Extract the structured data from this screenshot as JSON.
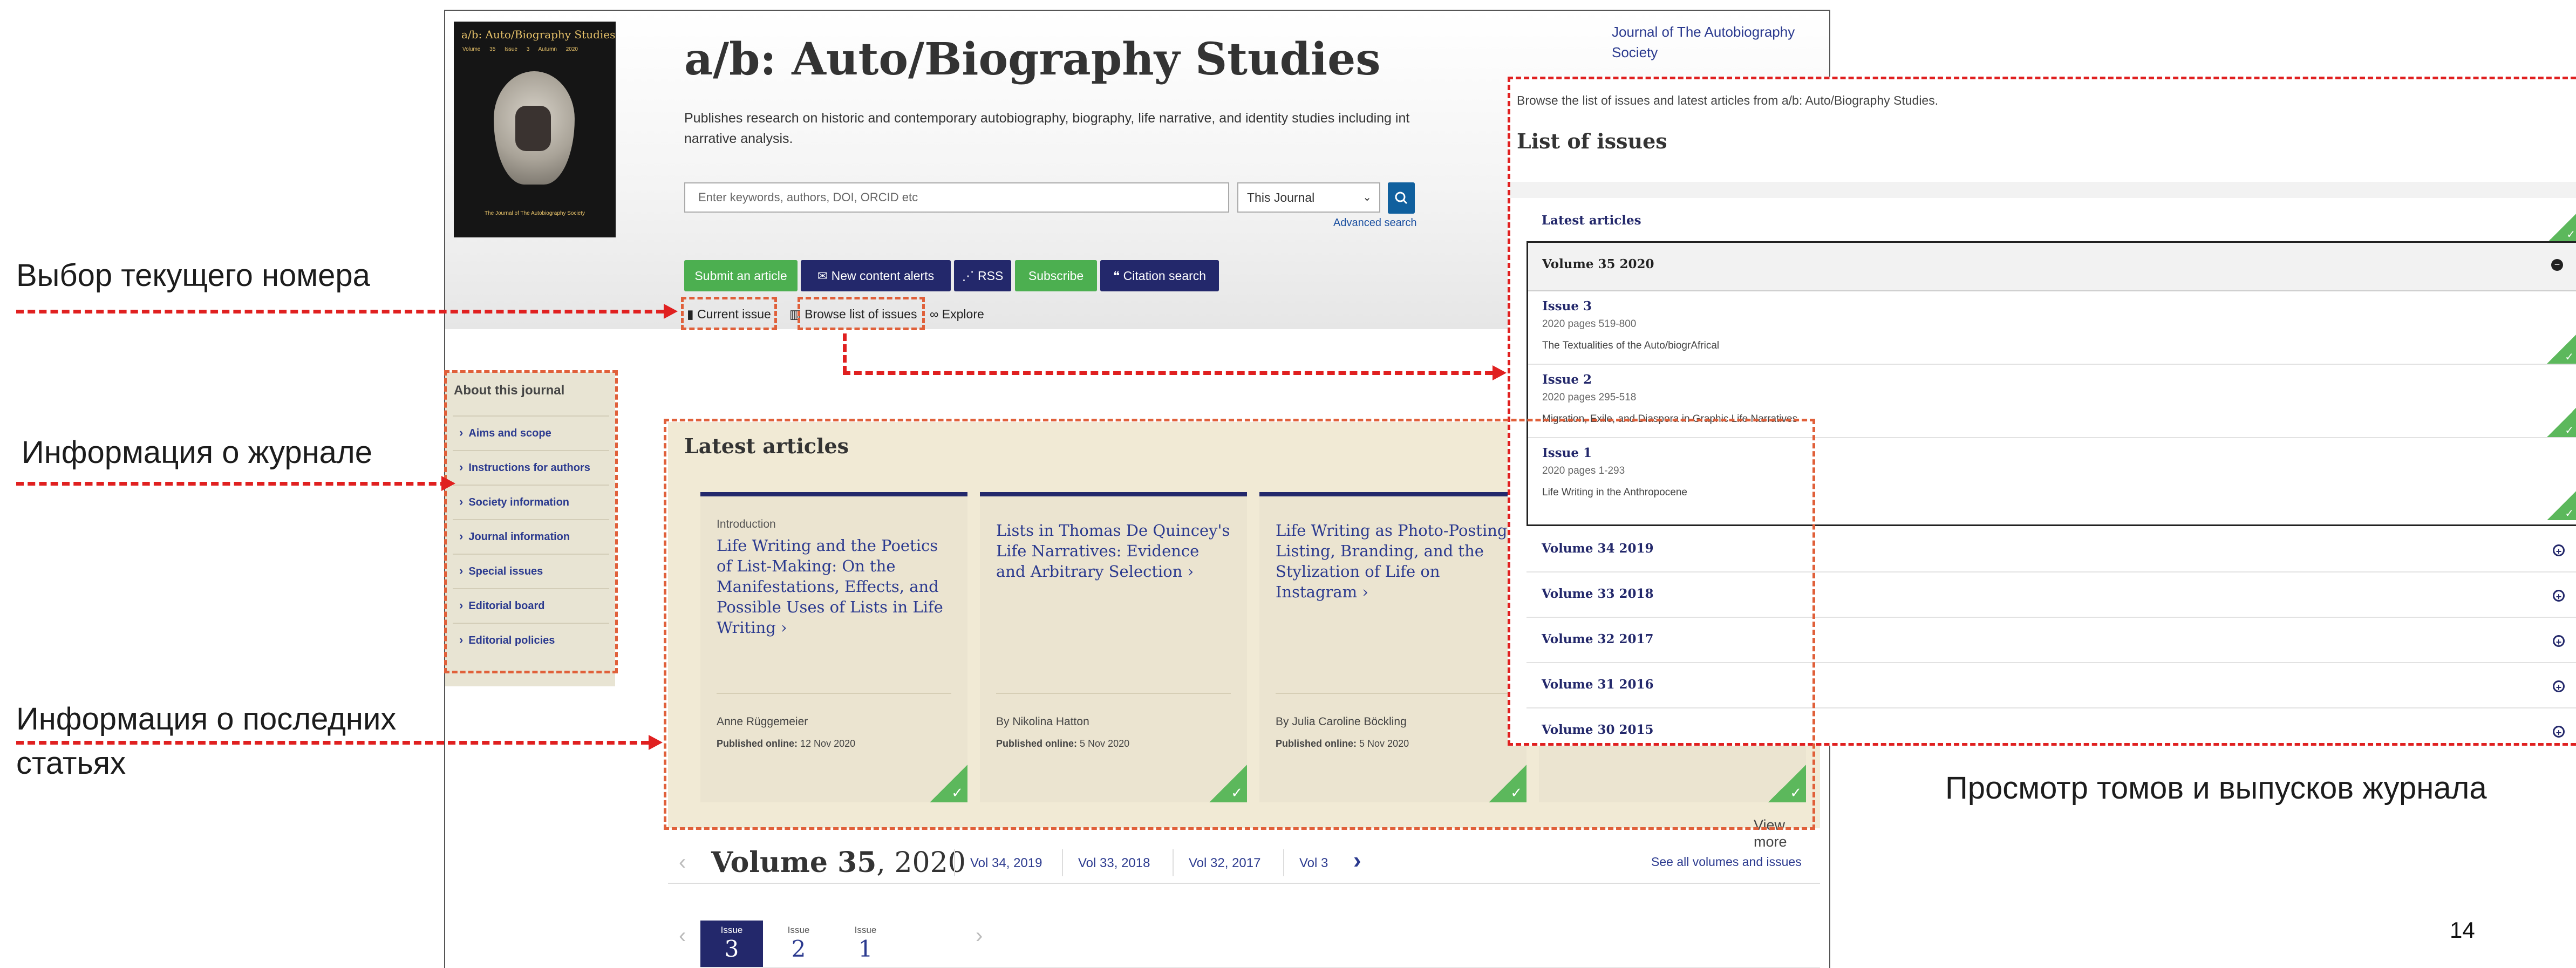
{
  "journal": {
    "title": "a/b: Auto/Biography Studies",
    "description": "Publishes research on historic and contemporary autobiography, biography, life narrative, and identity studies including int",
    "description_line2": "narrative analysis.",
    "society_link": "Journal of The Autobiography Society",
    "cover": {
      "title": "a/b: Auto/Biography Studies",
      "volume_line": "Volume 35 Issue 3 Autumn 2020",
      "caption": "The Journal of The Autobiography Society"
    }
  },
  "search": {
    "placeholder": "Enter keywords, authors, DOI, ORCID etc",
    "scope": "This Journal",
    "advanced": "Advanced search",
    "search_icon": "search-icon"
  },
  "actions": {
    "submit": "Submit an article",
    "alerts": "New content alerts",
    "rss": "RSS",
    "subscribe": "Subscribe",
    "citation": "Citation search"
  },
  "tabs": {
    "current": "Current issue",
    "browse": "Browse list of issues",
    "explore": "Explore"
  },
  "sidebar": {
    "title": "About this journal",
    "items": [
      {
        "label": "Aims and scope"
      },
      {
        "label": "Instructions for authors"
      },
      {
        "label": "Society information"
      },
      {
        "label": "Journal information"
      },
      {
        "label": "Special issues"
      },
      {
        "label": "Editorial board"
      },
      {
        "label": "Editorial policies"
      }
    ]
  },
  "latest": {
    "title": "Latest articles",
    "view_more": "View more",
    "cards": [
      {
        "label": "Introduction",
        "title": "Life Writing and the Poetics of List-Making: On the Manifestations, Effects, and Possible Uses of Lists in Life Writing",
        "author": "Anne Rüggemeier",
        "published_label": "Published online:",
        "published_date": "12 Nov 2020"
      },
      {
        "label": "",
        "title": "Lists in Thomas De Quincey's Life Narratives: Evidence and Arbitrary Selection",
        "author": "By Nikolina Hatton",
        "published_label": "Published online:",
        "published_date": "5 Nov 2020"
      },
      {
        "label": "",
        "title": "Life Writing as Photo-Posting: Listing, Branding, and the Stylization of Life on Instagram",
        "author": "By Julia Caroline Böckling",
        "published_label": "Published online:",
        "published_date": "5 Nov 2020"
      }
    ]
  },
  "volumes": {
    "current_label": "Volume 35",
    "current_year": ", 2020",
    "links": [
      "Vol 34, 2019",
      "Vol 33, 2018",
      "Vol 32, 2017",
      "Vol 3"
    ],
    "see_all": "See all volumes and issues"
  },
  "issues": [
    {
      "label": "Issue",
      "number": "3",
      "active": true
    },
    {
      "label": "Issue",
      "number": "2",
      "active": false
    },
    {
      "label": "Issue",
      "number": "1",
      "active": false
    }
  ],
  "panel": {
    "description": "Browse the list of issues and latest articles from a/b: Auto/Biography Studies.",
    "title": "List of issues",
    "latest_row": "Latest articles",
    "expanded_volume": "Volume 35 2020",
    "expanded_issues": [
      {
        "title": "Issue 3",
        "pages": "2020 pages 519-800",
        "theme": "The Textualities of the Auto/biogrAfrical"
      },
      {
        "title": "Issue 2",
        "pages": "2020 pages 295-518",
        "theme": "Migration, Exile, and Diaspora in Graphic Life Narratives"
      },
      {
        "title": "Issue 1",
        "pages": "2020 pages 1-293",
        "theme": "Life Writing in the Anthropocene"
      }
    ],
    "other_volumes": [
      "Volume 34 2019",
      "Volume 33 2018",
      "Volume 32 2017",
      "Volume 31 2016",
      "Volume 30 2015"
    ]
  },
  "annotations": {
    "current_issue": "Выбор текущего номера",
    "journal_info": "Информация о журнале",
    "latest_line1": "Информация о последних",
    "latest_line2": "статьях",
    "browse_volumes": "Просмотр томов и выпусков журнала",
    "page_number": "14"
  },
  "colors": {
    "navy": "#23286b",
    "green": "#4caf50",
    "annotation_red": "#e02020",
    "sidebar_bg": "#e8e4d3",
    "latest_bg": "#f1ead5"
  }
}
